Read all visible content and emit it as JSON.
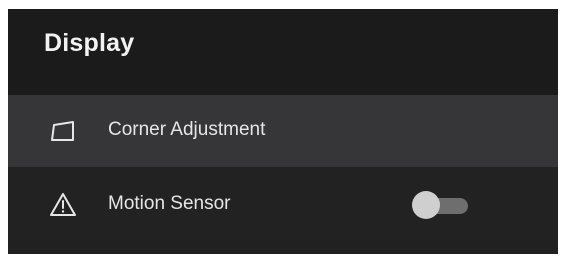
{
  "header": {
    "title": "Display"
  },
  "items": [
    {
      "label": "Corner Adjustment",
      "icon": "corner-adjustment-icon",
      "selected": true
    },
    {
      "label": "Motion Sensor",
      "icon": "warning-triangle-icon",
      "selected": false,
      "toggle": {
        "state": "off"
      }
    }
  ],
  "colors": {
    "background": "#212122",
    "header_background": "#1b1b1b",
    "selected_row": "#363638",
    "text": "#e6e6e6",
    "toggle_track": "#6e6e6e",
    "toggle_knob": "#cfcfcf"
  }
}
